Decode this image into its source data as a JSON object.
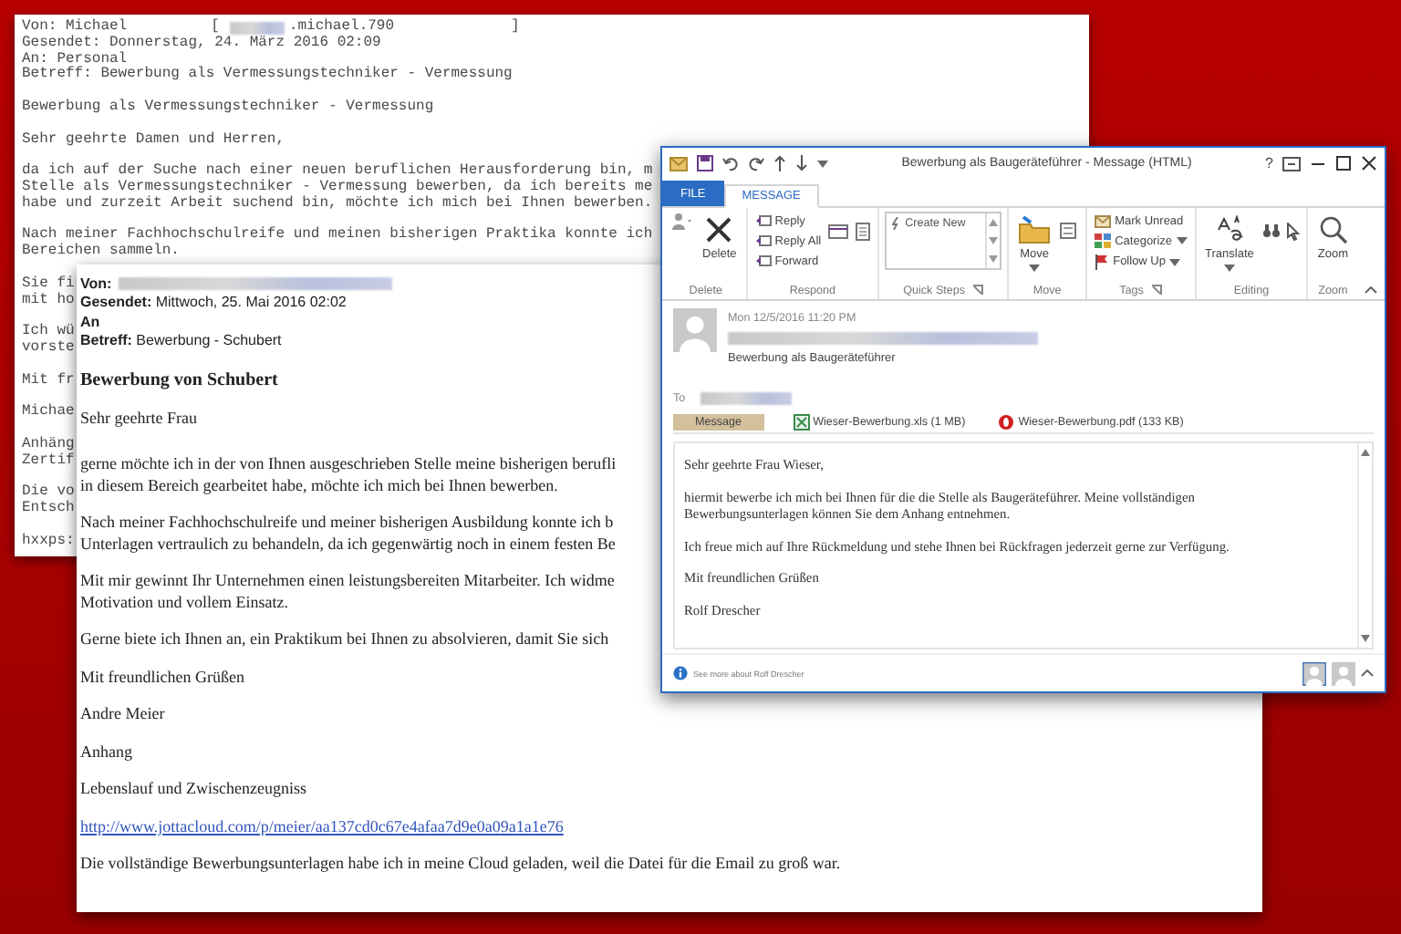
{
  "back_email": {
    "from": "Von: Michael",
    "open_bracket": "[",
    "address": ".michael.790",
    "close_bracket": "]",
    "header_lines": [
      "Gesendet: Donnerstag, 24. März 2016 02:09",
      "An: Personal",
      "Betreff: Bewerbung als Vermessungstechniker - Vermessung"
    ],
    "paragraphs": [
      [
        "Bewerbung als Vermessungstechniker - Vermessung"
      ],
      [
        "Sehr geehrte Damen und Herren,"
      ],
      [
        "da ich auf der Suche nach einer neuen beruflichen Herausforderung bin, m",
        "Stelle als Vermessungstechniker - Vermessung bewerben, da ich bereits me",
        "habe und zurzeit Arbeit suchend bin, möchte ich mich bei Ihnen bewerben."
      ],
      [
        "Nach meiner Fachhochschulreife und meinen bisherigen Praktika konnte ich",
        "Bereichen sammeln."
      ],
      [
        "Sie fi",
        "mit ho"
      ],
      [
        "Ich wü",
        "vorste"
      ],
      [
        "Mit fr"
      ],
      [
        "Michae"
      ],
      [
        "Anhäng",
        "Zertif"
      ],
      [
        "Die vo",
        "Entsch"
      ],
      [
        "hxxps:"
      ]
    ]
  },
  "forwarded_email": {
    "header_fields": [
      {
        "label": "Von:",
        "redacted": true
      },
      {
        "label": "Gesendet:",
        "value": "Mittwoch, 25. Mai 2016 02:02"
      },
      {
        "label": "An"
      },
      {
        "label": "Betreff:",
        "value": "Bewerbung - Schubert"
      }
    ],
    "paragraphs": [
      {
        "kind": "heading",
        "lines": [
          "Bewerbung von Schubert"
        ]
      },
      {
        "kind": "greeting",
        "lines": [
          "Sehr geehrte Frau"
        ]
      },
      {
        "kind": "text",
        "lines": [
          "gerne möchte ich in der von Ihnen ausgeschrieben Stelle meine bisherigen berufli",
          "in diesem Bereich gearbeitet habe, möchte ich mich bei Ihnen bewerben."
        ]
      },
      {
        "kind": "text",
        "lines": [
          "Nach meiner Fachhochschulreife und meiner bisherigen Ausbildung konnte ich b",
          "Unterlagen vertraulich zu behandeln, da ich gegenwärtig noch in einem festen Be"
        ]
      },
      {
        "kind": "text",
        "lines": [
          "Mit mir gewinnt Ihr Unternehmen einen leistungsbereiten Mitarbeiter. Ich widme",
          "Motivation und vollem Einsatz."
        ]
      },
      {
        "kind": "text",
        "lines": [
          "Gerne biete ich Ihnen an, ein Praktikum bei Ihnen zu absolvieren, damit Sie sich"
        ]
      },
      {
        "kind": "text",
        "lines": [
          "Mit freundlichen Grüßen"
        ]
      },
      {
        "kind": "text",
        "lines": [
          "Andre Meier"
        ]
      },
      {
        "kind": "text",
        "lines": [
          "Anhang"
        ]
      },
      {
        "kind": "text",
        "lines": [
          "Lebenslauf und Zwischenzeugniss"
        ]
      },
      {
        "kind": "link",
        "lines": [
          "http://www.jottacloud.com/p/meier/aa137cd0c67e4afaa7d9e0a09a1a1e76"
        ]
      },
      {
        "kind": "text",
        "lines": [
          "Die vollständige Bewerbungsunterlagen habe ich in meine Cloud geladen, weil die Datei für die Email zu groß war."
        ]
      }
    ]
  },
  "outlook_window": {
    "title": "Bewerbung als Baugeräteführer - Message (HTML)",
    "help": "?",
    "tabs": [
      {
        "label": "FILE",
        "kind": "backstage",
        "selected": false
      },
      {
        "label": "MESSAGE",
        "kind": "tab",
        "selected": true
      }
    ],
    "ribbon_groups": [
      {
        "label": "Delete",
        "buttons": [
          {
            "label": "Delete",
            "kind": "large",
            "dropdown": false
          }
        ]
      },
      {
        "label": "Respond",
        "buttons": [
          {
            "label": "Reply",
            "kind": "small",
            "dropdown": false
          },
          {
            "label": "Reply All",
            "kind": "small",
            "dropdown": false
          },
          {
            "label": "Forward",
            "kind": "small",
            "dropdown": false
          }
        ]
      },
      {
        "label": "Quick Steps",
        "buttons": [
          {
            "label": "Create New",
            "kind": "gallery"
          }
        ]
      },
      {
        "label": "Move",
        "buttons": [
          {
            "label": "Move",
            "kind": "large",
            "dropdown": true
          }
        ]
      },
      {
        "label": "Tags",
        "buttons": [
          {
            "label": "Mark Unread",
            "kind": "small",
            "dropdown": false
          },
          {
            "label": "Categorize",
            "kind": "small",
            "dropdown": true
          },
          {
            "label": "Follow Up",
            "kind": "small",
            "dropdown": true
          }
        ]
      },
      {
        "label": "Editing",
        "buttons": [
          {
            "label": "Translate",
            "kind": "large",
            "dropdown": true
          }
        ]
      },
      {
        "label": "Zoom",
        "buttons": [
          {
            "label": "Zoom",
            "kind": "large",
            "dropdown": false
          }
        ]
      }
    ],
    "message": {
      "date": "Mon 12/5/2016 11:20 PM",
      "subject": "Bewerbung als Baugeräteführer",
      "to_label": "To"
    },
    "attachments": [
      {
        "label": "Message",
        "kind": "message",
        "selected": true
      },
      {
        "label": "Wieser-Bewerbung.xls (1 MB)",
        "kind": "xls",
        "selected": false
      },
      {
        "label": "Wieser-Bewerbung.pdf (133 KB)",
        "kind": "pdf",
        "selected": false
      }
    ],
    "body_paragraphs": [
      [
        "Sehr geehrte Frau Wieser,"
      ],
      [
        "hiermit bewerbe ich mich bei Ihnen für die die Stelle als Baugeräteführer. Meine vollständigen",
        "Bewerbungsunterlagen können Sie dem Anhang entnehmen."
      ],
      [
        "Ich freue mich auf Ihre Rückmeldung und stehe Ihnen bei Rückfragen jederzeit gerne zur Verfügung."
      ],
      [
        "Mit freundlichen Grüßen"
      ],
      [
        "Rolf Drescher"
      ]
    ],
    "footer": "See more about Rolf Drescher"
  }
}
